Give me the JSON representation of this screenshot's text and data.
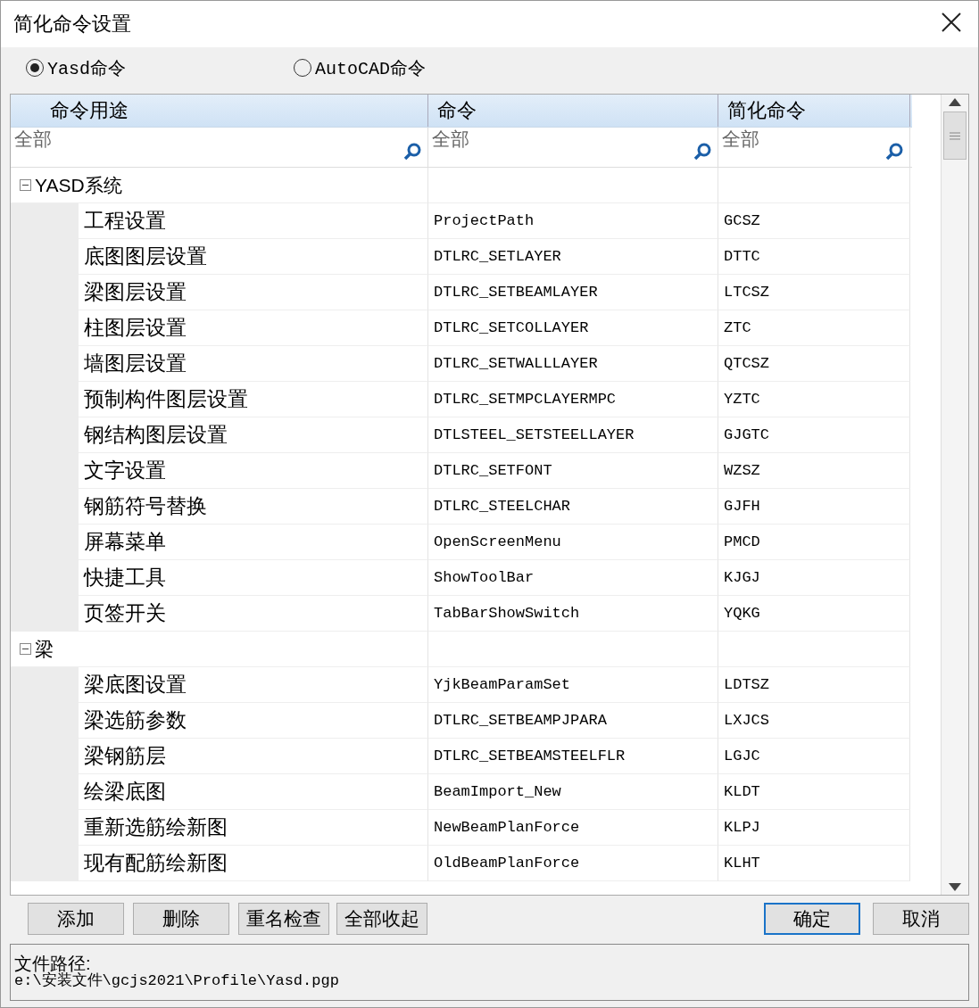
{
  "window": {
    "title": "简化命令设置"
  },
  "modes": [
    {
      "label": "Yasd命令",
      "selected": true
    },
    {
      "label": "AutoCAD命令",
      "selected": false
    }
  ],
  "table": {
    "columns": [
      {
        "title": "命令用途",
        "filter": "全部"
      },
      {
        "title": "命令",
        "filter": "全部"
      },
      {
        "title": "简化命令",
        "filter": "全部"
      }
    ],
    "groups": [
      {
        "label": "YASD系统",
        "expanded": true,
        "children": [
          {
            "purpose": "工程设置",
            "command": "ProjectPath",
            "short": "GCSZ"
          },
          {
            "purpose": "底图图层设置",
            "command": "DTLRC_SETLAYER",
            "short": "DTTC"
          },
          {
            "purpose": "梁图层设置",
            "command": "DTLRC_SETBEAMLAYER",
            "short": "LTCSZ"
          },
          {
            "purpose": "柱图层设置",
            "command": "DTLRC_SETCOLLAYER",
            "short": "ZTC"
          },
          {
            "purpose": "墙图层设置",
            "command": "DTLRC_SETWALLLAYER",
            "short": "QTCSZ"
          },
          {
            "purpose": "预制构件图层设置",
            "command": "DTLRC_SETMPCLAYERMPC",
            "short": "YZTC"
          },
          {
            "purpose": "钢结构图层设置",
            "command": "DTLSTEEL_SETSTEELLAYER",
            "short": "GJGTC"
          },
          {
            "purpose": "文字设置",
            "command": "DTLRC_SETFONT",
            "short": "WZSZ"
          },
          {
            "purpose": "钢筋符号替换",
            "command": "DTLRC_STEELCHAR",
            "short": "GJFH"
          },
          {
            "purpose": "屏幕菜单",
            "command": "OpenScreenMenu",
            "short": "PMCD"
          },
          {
            "purpose": "快捷工具",
            "command": "ShowToolBar",
            "short": "KJGJ"
          },
          {
            "purpose": "页签开关",
            "command": "TabBarShowSwitch",
            "short": "YQKG"
          }
        ]
      },
      {
        "label": "梁",
        "expanded": true,
        "children": [
          {
            "purpose": "梁底图设置",
            "command": "YjkBeamParamSet",
            "short": "LDTSZ"
          },
          {
            "purpose": "梁选筋参数",
            "command": "DTLRC_SETBEAMPJPARA",
            "short": "LXJCS"
          },
          {
            "purpose": "梁钢筋层",
            "command": "DTLRC_SETBEAMSTEELFLR",
            "short": "LGJC"
          },
          {
            "purpose": "绘梁底图",
            "command": "BeamImport_New",
            "short": "KLDT"
          },
          {
            "purpose": "重新选筋绘新图",
            "command": "NewBeamPlanForce",
            "short": "KLPJ"
          },
          {
            "purpose": "现有配筋绘新图",
            "command": "OldBeamPlanForce",
            "short": "KLHT"
          }
        ]
      }
    ]
  },
  "buttons": [
    {
      "label": "添加",
      "default": false
    },
    {
      "label": "删除",
      "default": false
    },
    {
      "label": "重名检查",
      "default": false
    },
    {
      "label": "全部收起",
      "default": false
    }
  ],
  "dialog_buttons": [
    {
      "label": "确定",
      "default": true
    },
    {
      "label": "取消",
      "default": false
    }
  ],
  "file_path": {
    "label": "文件路径:",
    "value": "e:\\安装文件\\gcjs2021\\Profile\\Yasd.pgp"
  }
}
